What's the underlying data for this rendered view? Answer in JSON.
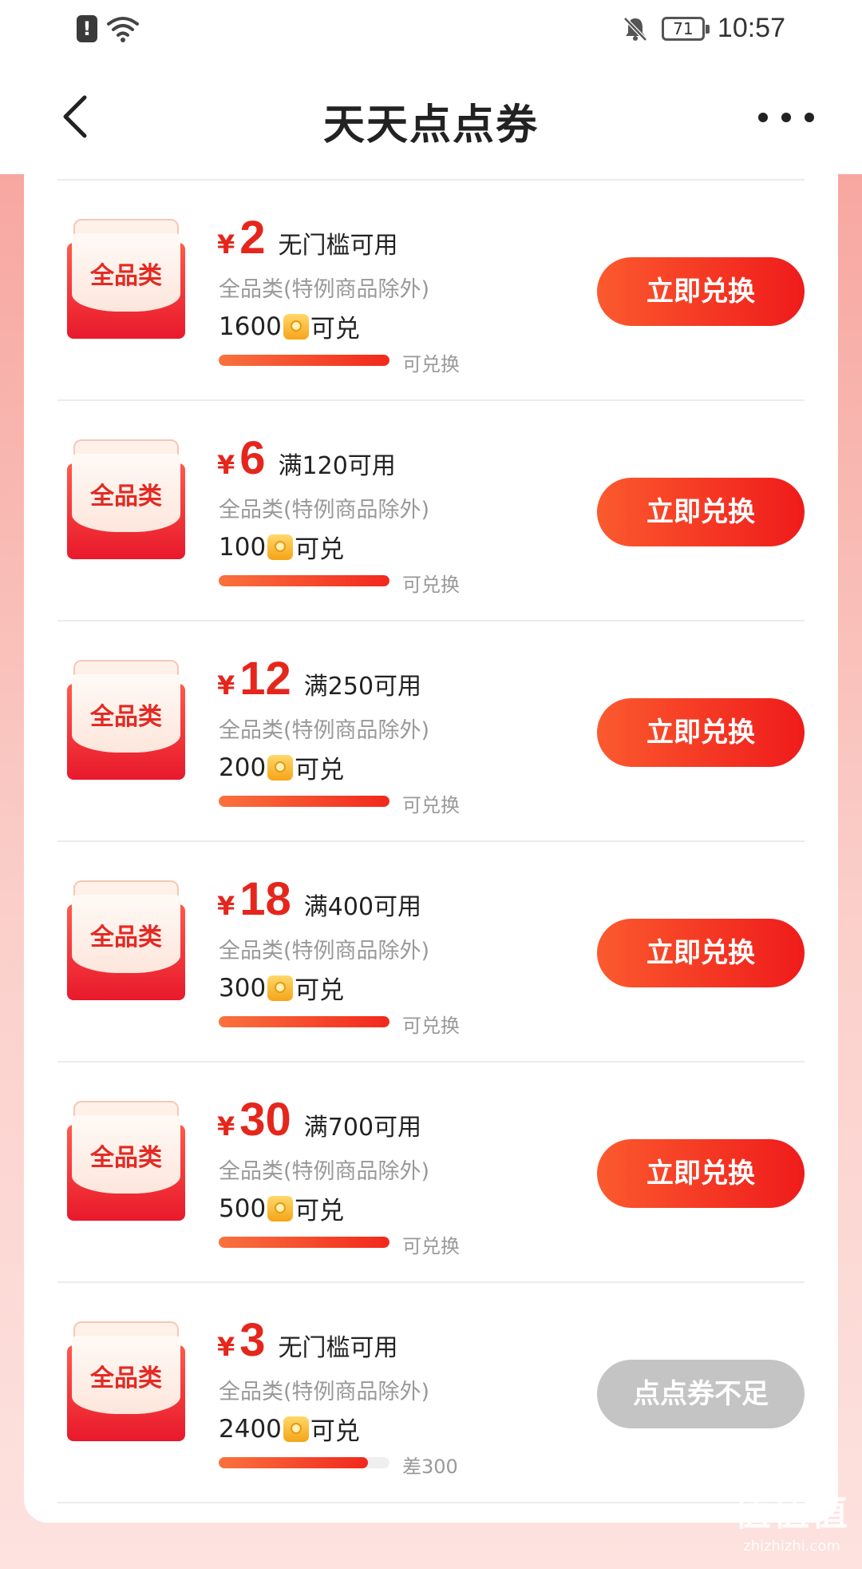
{
  "status_bar": {
    "time": "10:57",
    "battery": "71",
    "icons": [
      "alert-icon",
      "wifi-icon",
      "bell-muted-icon",
      "battery-icon"
    ]
  },
  "header": {
    "title": "天天点点券",
    "back_icon": "chevron-left-icon",
    "more_icon": "more-dots-icon"
  },
  "coupons": [
    {
      "badge": "全品类",
      "yen": "¥",
      "amount": "2",
      "condition": "无门槛可用",
      "scope": "全品类(特例商品除外)",
      "cost": "1600",
      "cost_suffix": "可兑",
      "progress": 1.0,
      "progress_text": "可兑换",
      "button": "立即兑换",
      "enabled": true
    },
    {
      "badge": "全品类",
      "yen": "¥",
      "amount": "6",
      "condition": "满120可用",
      "scope": "全品类(特例商品除外)",
      "cost": "100",
      "cost_suffix": "可兑",
      "progress": 1.0,
      "progress_text": "可兑换",
      "button": "立即兑换",
      "enabled": true
    },
    {
      "badge": "全品类",
      "yen": "¥",
      "amount": "12",
      "condition": "满250可用",
      "scope": "全品类(特例商品除外)",
      "cost": "200",
      "cost_suffix": "可兑",
      "progress": 1.0,
      "progress_text": "可兑换",
      "button": "立即兑换",
      "enabled": true
    },
    {
      "badge": "全品类",
      "yen": "¥",
      "amount": "18",
      "condition": "满400可用",
      "scope": "全品类(特例商品除外)",
      "cost": "300",
      "cost_suffix": "可兑",
      "progress": 1.0,
      "progress_text": "可兑换",
      "button": "立即兑换",
      "enabled": true
    },
    {
      "badge": "全品类",
      "yen": "¥",
      "amount": "30",
      "condition": "满700可用",
      "scope": "全品类(特例商品除外)",
      "cost": "500",
      "cost_suffix": "可兑",
      "progress": 1.0,
      "progress_text": "可兑换",
      "button": "立即兑换",
      "enabled": true
    },
    {
      "badge": "全品类",
      "yen": "¥",
      "amount": "3",
      "condition": "无门槛可用",
      "scope": "全品类(特例商品除外)",
      "cost": "2400",
      "cost_suffix": "可兑",
      "progress": 0.875,
      "progress_text": "差300",
      "button": "点点券不足",
      "enabled": false
    }
  ],
  "watermark": {
    "logo": "值值值",
    "url": "zhizhizhi.com"
  }
}
